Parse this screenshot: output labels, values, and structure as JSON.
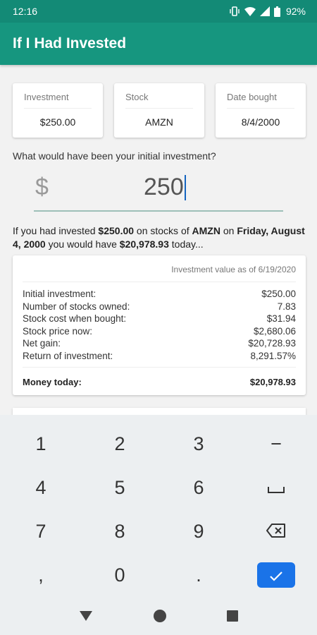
{
  "status_bar": {
    "time": "12:16",
    "battery": "92%"
  },
  "app_bar": {
    "title": "If I Had Invested"
  },
  "summary": [
    {
      "label": "Investment",
      "value": "$250.00"
    },
    {
      "label": "Stock",
      "value": "AMZN"
    },
    {
      "label": "Date bought",
      "value": "8/4/2000"
    }
  ],
  "question": "What would have been your initial investment?",
  "amount_field": {
    "currency": "$",
    "value": "250"
  },
  "sentence": {
    "t1": "If you had invested ",
    "amount": "$250.00",
    "t2": " on stocks of ",
    "ticker": "AMZN",
    "t3": " on ",
    "date": "Friday, August 4, 2000",
    "t4": " you would have ",
    "result": "$20,978.93",
    "t5": " today..."
  },
  "result_card": {
    "as_of": "Investment value as of 6/19/2020",
    "rows": [
      {
        "label": "Initial investment:",
        "value": "$250.00"
      },
      {
        "label": "Number of stocks owned:",
        "value": "7.83"
      },
      {
        "label": "Stock cost when bought:",
        "value": "$31.94"
      },
      {
        "label": "Stock price now:",
        "value": "$2,680.06"
      },
      {
        "label": "Net gain:",
        "value": "$20,728.93"
      },
      {
        "label": "Return of investment:",
        "value": "8,291.57%"
      }
    ],
    "total_label": "Money today:",
    "total_value": "$20,978.93"
  },
  "keyboard": {
    "keys": [
      "1",
      "2",
      "3",
      "−",
      "4",
      "5",
      "6",
      "space-icon",
      "7",
      "8",
      "9",
      "backspace-icon",
      ",",
      "0",
      ".",
      "enter-icon"
    ]
  },
  "colors": {
    "status_bar": "#138a76",
    "app_bar": "#16967f",
    "enter_key": "#1a73e8"
  }
}
